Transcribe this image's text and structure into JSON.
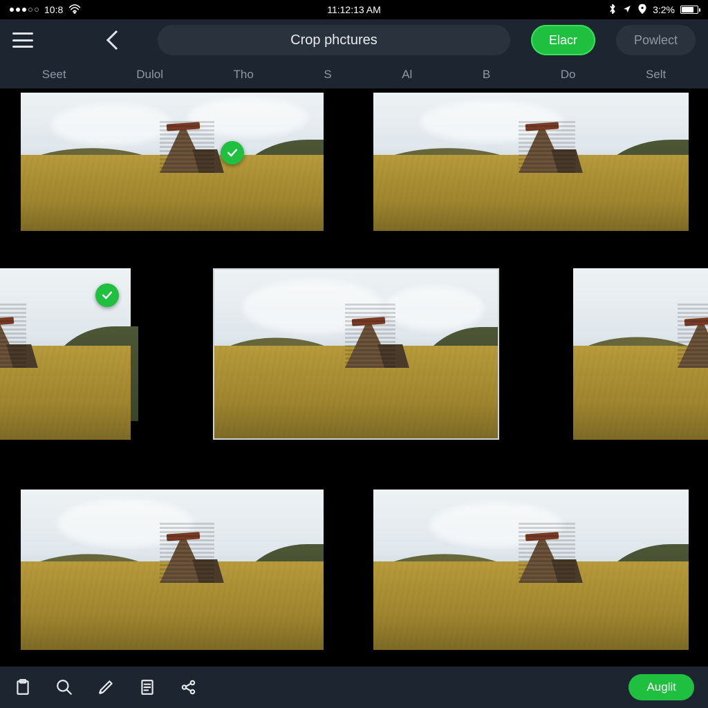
{
  "statusbar": {
    "carrier_time_left": "10:8",
    "clock": "11:12:13 AM",
    "battery_pct": "3:2%"
  },
  "header": {
    "title": "Crop phctures",
    "primary_btn": "Elacr",
    "secondary_btn": "Powlect"
  },
  "tabs": [
    "Seet",
    "Dulol",
    "Tho",
    "S",
    "Al",
    "B",
    "Do",
    "Selt"
  ],
  "grid": {
    "items": [
      {
        "selected": true
      },
      {
        "selected": false
      },
      {
        "selected": true
      },
      {
        "selected": false
      },
      {
        "selected": false
      },
      {
        "selected": false
      },
      {
        "selected": false
      }
    ]
  },
  "toolbar": {
    "apply_label": "Auglit"
  },
  "colors": {
    "accent": "#1fbf3f",
    "panel": "#1d2530",
    "pill": "#2a323d"
  }
}
